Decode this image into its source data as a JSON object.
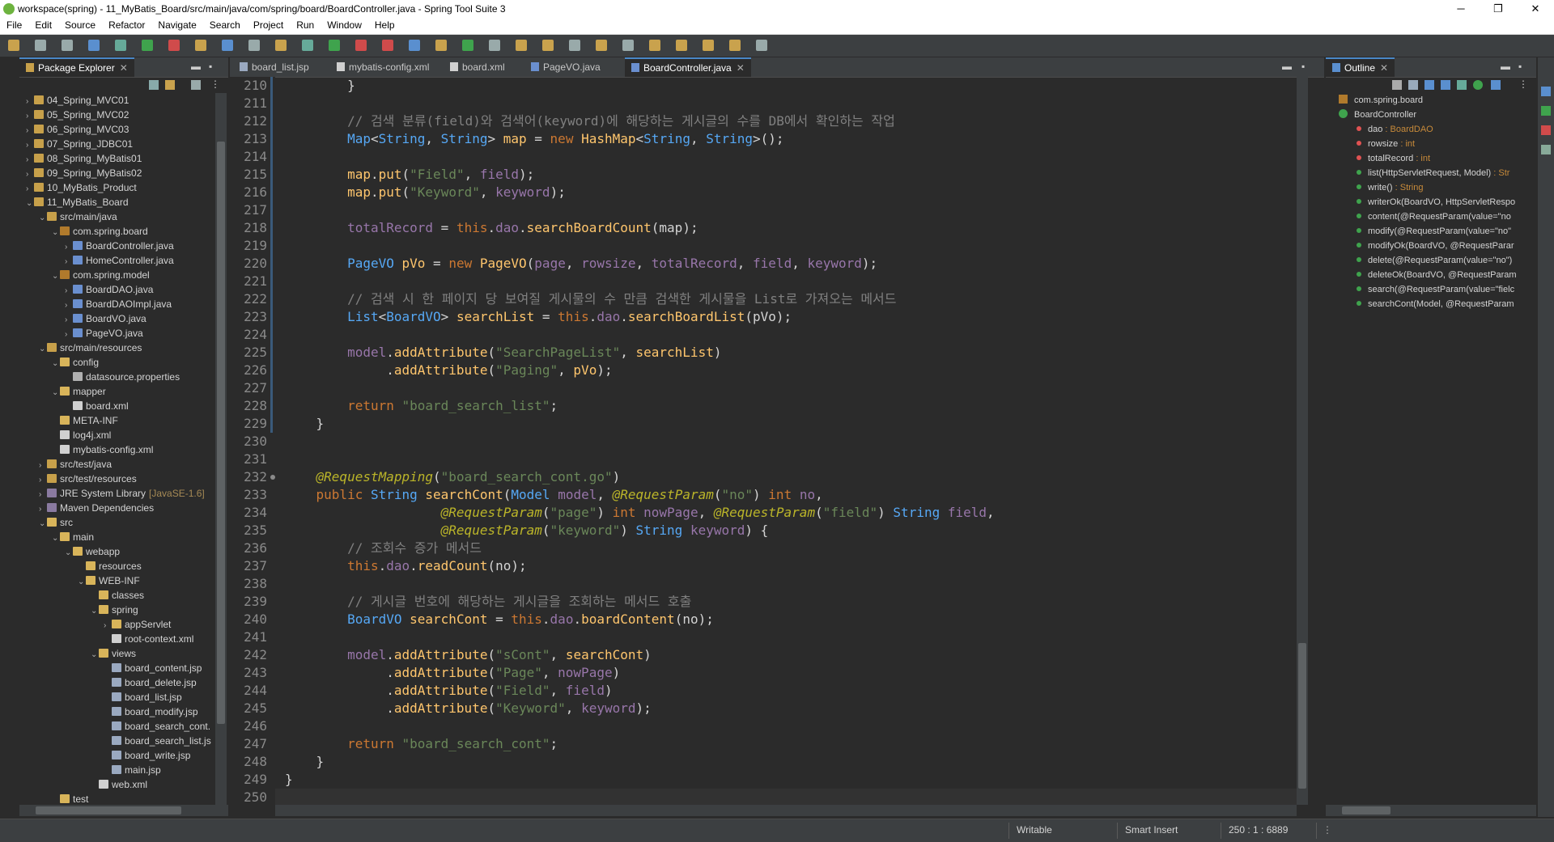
{
  "window": {
    "title": "workspace(spring) - 11_MyBatis_Board/src/main/java/com/spring/board/BoardController.java - Spring Tool Suite 3",
    "minimize": "─",
    "maximize": "❐",
    "close": "✕"
  },
  "menu": [
    "File",
    "Edit",
    "Source",
    "Refactor",
    "Navigate",
    "Search",
    "Project",
    "Run",
    "Window",
    "Help"
  ],
  "package_explorer": {
    "title": "Package Explorer",
    "items": [
      {
        "label": "04_Spring_MVC01",
        "depth": 0,
        "arrow": "›",
        "icon": "proj"
      },
      {
        "label": "05_Spring_MVC02",
        "depth": 0,
        "arrow": "›",
        "icon": "proj"
      },
      {
        "label": "06_Spring_MVC03",
        "depth": 0,
        "arrow": "›",
        "icon": "proj"
      },
      {
        "label": "07_Spring_JDBC01",
        "depth": 0,
        "arrow": "›",
        "icon": "proj"
      },
      {
        "label": "08_Spring_MyBatis01",
        "depth": 0,
        "arrow": "›",
        "icon": "proj"
      },
      {
        "label": "09_Spring_MyBatis02",
        "depth": 0,
        "arrow": "›",
        "icon": "proj"
      },
      {
        "label": "10_MyBatis_Product",
        "depth": 0,
        "arrow": "›",
        "icon": "proj"
      },
      {
        "label": "11_MyBatis_Board",
        "depth": 0,
        "arrow": "⌄",
        "icon": "proj"
      },
      {
        "label": "src/main/java",
        "depth": 1,
        "arrow": "⌄",
        "icon": "src"
      },
      {
        "label": "com.spring.board",
        "depth": 2,
        "arrow": "⌄",
        "icon": "pkg"
      },
      {
        "label": "BoardController.java",
        "depth": 3,
        "arrow": "›",
        "icon": "java"
      },
      {
        "label": "HomeController.java",
        "depth": 3,
        "arrow": "›",
        "icon": "java"
      },
      {
        "label": "com.spring.model",
        "depth": 2,
        "arrow": "⌄",
        "icon": "pkg"
      },
      {
        "label": "BoardDAO.java",
        "depth": 3,
        "arrow": "›",
        "icon": "java"
      },
      {
        "label": "BoardDAOImpl.java",
        "depth": 3,
        "arrow": "›",
        "icon": "java"
      },
      {
        "label": "BoardVO.java",
        "depth": 3,
        "arrow": "›",
        "icon": "java"
      },
      {
        "label": "PageVO.java",
        "depth": 3,
        "arrow": "›",
        "icon": "java"
      },
      {
        "label": "src/main/resources",
        "depth": 1,
        "arrow": "⌄",
        "icon": "src"
      },
      {
        "label": "config",
        "depth": 2,
        "arrow": "⌄",
        "icon": "folder"
      },
      {
        "label": "datasource.properties",
        "depth": 3,
        "arrow": "",
        "icon": "prop"
      },
      {
        "label": "mapper",
        "depth": 2,
        "arrow": "⌄",
        "icon": "folder"
      },
      {
        "label": "board.xml",
        "depth": 3,
        "arrow": "",
        "icon": "xml"
      },
      {
        "label": "META-INF",
        "depth": 2,
        "arrow": "",
        "icon": "folder"
      },
      {
        "label": "log4j.xml",
        "depth": 2,
        "arrow": "",
        "icon": "xml"
      },
      {
        "label": "mybatis-config.xml",
        "depth": 2,
        "arrow": "",
        "icon": "xml"
      },
      {
        "label": "src/test/java",
        "depth": 1,
        "arrow": "›",
        "icon": "src"
      },
      {
        "label": "src/test/resources",
        "depth": 1,
        "arrow": "›",
        "icon": "src"
      },
      {
        "label": "JRE System Library",
        "suffix": "[JavaSE-1.6]",
        "depth": 1,
        "arrow": "›",
        "icon": "lib"
      },
      {
        "label": "Maven Dependencies",
        "depth": 1,
        "arrow": "›",
        "icon": "lib"
      },
      {
        "label": "src",
        "depth": 1,
        "arrow": "⌄",
        "icon": "folder"
      },
      {
        "label": "main",
        "depth": 2,
        "arrow": "⌄",
        "icon": "folder"
      },
      {
        "label": "webapp",
        "depth": 3,
        "arrow": "⌄",
        "icon": "folder"
      },
      {
        "label": "resources",
        "depth": 4,
        "arrow": "",
        "icon": "folder"
      },
      {
        "label": "WEB-INF",
        "depth": 4,
        "arrow": "⌄",
        "icon": "folder"
      },
      {
        "label": "classes",
        "depth": 5,
        "arrow": "",
        "icon": "folder"
      },
      {
        "label": "spring",
        "depth": 5,
        "arrow": "⌄",
        "icon": "folder"
      },
      {
        "label": "appServlet",
        "depth": 6,
        "arrow": "›",
        "icon": "folder"
      },
      {
        "label": "root-context.xml",
        "depth": 6,
        "arrow": "",
        "icon": "xml"
      },
      {
        "label": "views",
        "depth": 5,
        "arrow": "⌄",
        "icon": "folder"
      },
      {
        "label": "board_content.jsp",
        "depth": 6,
        "arrow": "",
        "icon": "jsp"
      },
      {
        "label": "board_delete.jsp",
        "depth": 6,
        "arrow": "",
        "icon": "jsp"
      },
      {
        "label": "board_list.jsp",
        "depth": 6,
        "arrow": "",
        "icon": "jsp"
      },
      {
        "label": "board_modify.jsp",
        "depth": 6,
        "arrow": "",
        "icon": "jsp"
      },
      {
        "label": "board_search_cont.",
        "depth": 6,
        "arrow": "",
        "icon": "jsp"
      },
      {
        "label": "board_search_list.js",
        "depth": 6,
        "arrow": "",
        "icon": "jsp"
      },
      {
        "label": "board_write.jsp",
        "depth": 6,
        "arrow": "",
        "icon": "jsp"
      },
      {
        "label": "main.jsp",
        "depth": 6,
        "arrow": "",
        "icon": "jsp"
      },
      {
        "label": "web.xml",
        "depth": 5,
        "arrow": "",
        "icon": "xml"
      },
      {
        "label": "test",
        "depth": 2,
        "arrow": "",
        "icon": "folder"
      }
    ]
  },
  "editor": {
    "tabs": [
      {
        "label": "board_list.jsp",
        "active": false
      },
      {
        "label": "mybatis-config.xml",
        "active": false
      },
      {
        "label": "board.xml",
        "active": false
      },
      {
        "label": "PageVO.java",
        "active": false
      },
      {
        "label": "BoardController.java",
        "active": true
      }
    ],
    "lines": [
      {
        "n": "210",
        "html": "        }"
      },
      {
        "n": "211",
        "html": ""
      },
      {
        "n": "212",
        "html": "        <span class='cm'>// 검색 분류(field)와 검색어(keyword)에 해당하는 게시글의 수를 DB에서 확인하는 작업</span>"
      },
      {
        "n": "213",
        "html": "        <span class='ty'>Map</span>&lt;<span class='ty'>String</span>, <span class='ty'>String</span>&gt; <span class='mt'>map</span> = <span class='kw'>new</span> <span class='mt'>HashMap</span>&lt;<span class='ty'>String</span>, <span class='ty'>String</span>&gt;();"
      },
      {
        "n": "214",
        "html": ""
      },
      {
        "n": "215",
        "html": "        <span class='mt'>map</span>.<span class='mt'>put</span>(<span class='st'>\"Field\"</span>, <span class='fd'>field</span>);"
      },
      {
        "n": "216",
        "html": "        <span class='mt'>map</span>.<span class='mt'>put</span>(<span class='st'>\"Keyword\"</span>, <span class='fd'>keyword</span>);"
      },
      {
        "n": "217",
        "html": ""
      },
      {
        "n": "218",
        "html": "        <span class='fd'>totalRecord</span> = <span class='kw'>this</span>.<span class='fd'>dao</span>.<span class='mt'>searchBoardCount</span>(map);"
      },
      {
        "n": "219",
        "html": ""
      },
      {
        "n": "220",
        "html": "        <span class='ty'>PageVO</span> <span class='mt'>pVo</span> = <span class='kw'>new</span> <span class='mt'>PageVO</span>(<span class='fd'>page</span>, <span class='fd'>rowsize</span>, <span class='fd'>totalRecord</span>, <span class='fd'>field</span>, <span class='fd'>keyword</span>);"
      },
      {
        "n": "221",
        "html": ""
      },
      {
        "n": "222",
        "html": "        <span class='cm'>// 검색 시 한 페이지 당 보여질 게시물의 수 만큼 검색한 게시물을 List로 가져오는 메서드</span>"
      },
      {
        "n": "223",
        "html": "        <span class='ty'>List</span>&lt;<span class='ty'>BoardVO</span>&gt; <span class='mt'>searchList</span> = <span class='kw'>this</span>.<span class='fd'>dao</span>.<span class='mt'>searchBoardList</span>(pVo);"
      },
      {
        "n": "224",
        "html": ""
      },
      {
        "n": "225",
        "html": "        <span class='fd'>model</span>.<span class='mt'>addAttribute</span>(<span class='st'>\"SearchPageList\"</span>, <span class='mt'>searchList</span>)"
      },
      {
        "n": "226",
        "html": "             .<span class='mt'>addAttribute</span>(<span class='st'>\"Paging\"</span>, <span class='mt'>pVo</span>);"
      },
      {
        "n": "227",
        "html": ""
      },
      {
        "n": "228",
        "html": "        <span class='kw'>return</span> <span class='st'>\"board_search_list\"</span>;"
      },
      {
        "n": "229",
        "html": "    }"
      },
      {
        "n": "230",
        "html": ""
      },
      {
        "n": "231",
        "html": ""
      },
      {
        "n": "232",
        "html": "    <span class='an'>@RequestMapping</span>(<span class='st'>\"board_search_cont.go\"</span>)"
      },
      {
        "n": "233",
        "html": "    <span class='kw'>public</span> <span class='ty'>String</span> <span class='mt'>searchCont</span>(<span class='ty'>Model</span> <span class='fd'>model</span>, <span class='an'>@RequestParam</span>(<span class='st'>\"no\"</span>) <span class='kw'>int</span> <span class='fd'>no</span>,"
      },
      {
        "n": "234",
        "html": "                    <span class='an'>@RequestParam</span>(<span class='st'>\"page\"</span>) <span class='kw'>int</span> <span class='fd'>nowPage</span>, <span class='an'>@RequestParam</span>(<span class='st'>\"field\"</span>) <span class='ty'>String</span> <span class='fd'>field</span>,"
      },
      {
        "n": "235",
        "html": "                    <span class='an'>@RequestParam</span>(<span class='st'>\"keyword\"</span>) <span class='ty'>String</span> <span class='fd'>keyword</span>) {"
      },
      {
        "n": "236",
        "html": "        <span class='cm'>// 조회수 증가 메서드</span>"
      },
      {
        "n": "237",
        "html": "        <span class='kw'>this</span>.<span class='fd'>dao</span>.<span class='mt'>readCount</span>(no);"
      },
      {
        "n": "238",
        "html": ""
      },
      {
        "n": "239",
        "html": "        <span class='cm'>// 게시글 번호에 해당하는 게시글을 조회하는 메서드 호출</span>"
      },
      {
        "n": "240",
        "html": "        <span class='ty'>BoardVO</span> <span class='mt'>searchCont</span> = <span class='kw'>this</span>.<span class='fd'>dao</span>.<span class='mt'>boardContent</span>(no);"
      },
      {
        "n": "241",
        "html": ""
      },
      {
        "n": "242",
        "html": "        <span class='fd'>model</span>.<span class='mt'>addAttribute</span>(<span class='st'>\"sCont\"</span>, <span class='mt'>searchCont</span>)"
      },
      {
        "n": "243",
        "html": "             .<span class='mt'>addAttribute</span>(<span class='st'>\"Page\"</span>, <span class='fd'>nowPage</span>)"
      },
      {
        "n": "244",
        "html": "             .<span class='mt'>addAttribute</span>(<span class='st'>\"Field\"</span>, <span class='fd'>field</span>)"
      },
      {
        "n": "245",
        "html": "             .<span class='mt'>addAttribute</span>(<span class='st'>\"Keyword\"</span>, <span class='fd'>keyword</span>);"
      },
      {
        "n": "246",
        "html": ""
      },
      {
        "n": "247",
        "html": "        <span class='kw'>return</span> <span class='st'>\"board_search_cont\"</span>;"
      },
      {
        "n": "248",
        "html": "    }"
      },
      {
        "n": "249",
        "html": "}"
      },
      {
        "n": "250",
        "html": ""
      }
    ]
  },
  "outline": {
    "title": "Outline",
    "items": [
      {
        "label": "com.spring.board",
        "type": "",
        "marker": "pkg",
        "depth": 0
      },
      {
        "label": "BoardController",
        "type": "",
        "marker": "class",
        "depth": 0
      },
      {
        "label": "dao",
        "type": " : BoardDAO",
        "marker": "red",
        "depth": 1
      },
      {
        "label": "rowsize",
        "type": " : int",
        "marker": "red",
        "depth": 1
      },
      {
        "label": "totalRecord",
        "type": " : int",
        "marker": "red",
        "depth": 1
      },
      {
        "label": "list(HttpServletRequest, Model)",
        "type": " : Str",
        "marker": "green",
        "depth": 1
      },
      {
        "label": "write()",
        "type": " : String",
        "marker": "green",
        "depth": 1
      },
      {
        "label": "writerOk(BoardVO, HttpServletRespo",
        "type": "",
        "marker": "green",
        "depth": 1
      },
      {
        "label": "content(@RequestParam(value=\"no",
        "type": "",
        "marker": "green",
        "depth": 1
      },
      {
        "label": "modify(@RequestParam(value=\"no\"",
        "type": "",
        "marker": "green",
        "depth": 1
      },
      {
        "label": "modifyOk(BoardVO, @RequestParar",
        "type": "",
        "marker": "green",
        "depth": 1
      },
      {
        "label": "delete(@RequestParam(value=\"no\")",
        "type": "",
        "marker": "green",
        "depth": 1
      },
      {
        "label": "deleteOk(BoardVO, @RequestParam",
        "type": "",
        "marker": "green",
        "depth": 1
      },
      {
        "label": "search(@RequestParam(value=\"fielc",
        "type": "",
        "marker": "green",
        "depth": 1
      },
      {
        "label": "searchCont(Model, @RequestParam",
        "type": "",
        "marker": "green",
        "depth": 1
      }
    ]
  },
  "status": {
    "writable": "Writable",
    "insert_mode": "Smart Insert",
    "position": "250 : 1 : 6889"
  }
}
